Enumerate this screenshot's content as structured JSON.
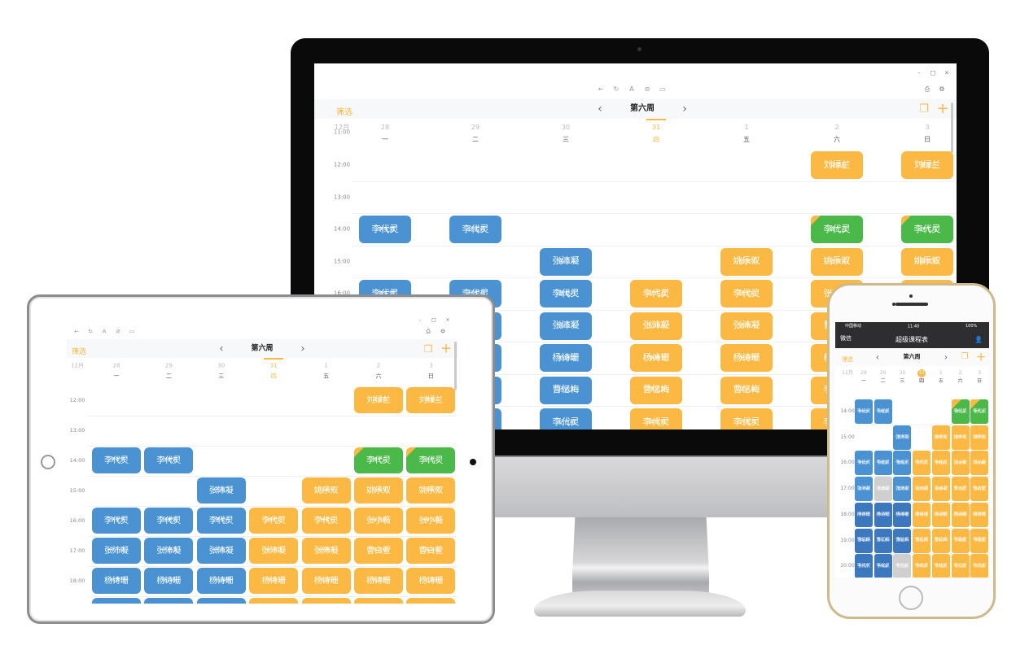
{
  "app": {
    "filter_label": "筛选",
    "week_label": "第六周",
    "month_label": "12月",
    "phone_title": "超级课程表",
    "phone_back": "微信",
    "carrier": "中国移动",
    "clock": "11:40",
    "battery": "100%"
  },
  "icons": {
    "back": "←",
    "refresh": "↻",
    "font": "A",
    "link": "⊘",
    "window": "▭",
    "share": "⎙",
    "settings": "⚙",
    "minimize": "-",
    "maximize": "□",
    "close": "×",
    "prev": "‹",
    "next": "›",
    "copy": "❐",
    "add": "+",
    "dropdown": "▾",
    "user": "👤",
    "wifi": "ᯤ"
  },
  "colors": {
    "accent": "#fbb944",
    "blue": "#4a92d2",
    "orange": "#fbb944",
    "green": "#4bb84a",
    "gray": "#cfcfcf",
    "darkblue": "#3b78bd"
  },
  "days": [
    {
      "date": "28",
      "weekday": "一"
    },
    {
      "date": "29",
      "weekday": "二"
    },
    {
      "date": "30",
      "weekday": "三"
    },
    {
      "date": "31",
      "weekday": "四"
    },
    {
      "date": "1",
      "weekday": "五"
    },
    {
      "date": "2",
      "weekday": "六"
    },
    {
      "date": "3",
      "weekday": "日"
    }
  ],
  "today_index": 3,
  "extra_time_label": "11:00",
  "schedule": [
    {
      "time": "12:00",
      "cells": [
        null,
        null,
        null,
        null,
        null,
        {
          "teacher": "刘绿兰",
          "student": "文伟嘉",
          "color": "orange"
        },
        {
          "teacher": "刘绿兰",
          "student": "萧盈兰",
          "color": "orange"
        }
      ]
    },
    {
      "time": "13:00",
      "cells": [
        null,
        null,
        null,
        null,
        null,
        null,
        null
      ]
    },
    {
      "time": "14:00",
      "cells": [
        {
          "teacher": "李代灵",
          "student": "李安梦",
          "color": "blue"
        },
        {
          "teacher": "李代灵",
          "student": "邱碧蓉",
          "color": "blue"
        },
        null,
        null,
        null,
        {
          "teacher": "李代灵",
          "student": "周芷云",
          "color": "green"
        },
        {
          "teacher": "李代灵",
          "student": "赵凡儿",
          "color": "green"
        }
      ]
    },
    {
      "time": "15:00",
      "cells": [
        null,
        null,
        {
          "teacher": "张沛凝",
          "student": "董凌文",
          "color": "blue"
        },
        null,
        {
          "teacher": "姚乐双",
          "student": "张绮琴",
          "color": "orange"
        },
        {
          "teacher": "姚乐双",
          "student": "张绮琴",
          "color": "orange"
        },
        {
          "teacher": "姚乐双",
          "student": "谭翠阳",
          "color": "orange"
        }
      ]
    },
    {
      "time": "16:00",
      "cells": [
        {
          "teacher": "李代灵",
          "student": "李安梦",
          "color": "blue"
        },
        {
          "teacher": "李代灵",
          "student": "邱碧蓉",
          "color": "blue"
        },
        {
          "teacher": "李代灵",
          "student": "董凝丹",
          "color": "blue"
        },
        {
          "teacher": "李代灵",
          "student": "胡巧蕊",
          "color": "orange"
        },
        {
          "teacher": "李代灵",
          "student": "钟青柏",
          "color": "orange"
        },
        {
          "teacher": "张小薇",
          "student": "吴语彤",
          "color": "orange"
        },
        {
          "teacher": "张小薇",
          "student": "薛钰馨",
          "color": "orange"
        }
      ]
    },
    {
      "time": "17:00",
      "cells": [
        {
          "teacher": "张沛凝",
          "student": "李千柳",
          "color": "blue"
        },
        {
          "teacher": "张沛凝",
          "student": "李思柔",
          "color": "blue",
          "phone_color": "gray"
        },
        {
          "teacher": "张沛凝",
          "student": "董凌文",
          "color": "blue"
        },
        {
          "teacher": "张沛凝",
          "student": "纪冰双",
          "color": "orange"
        },
        {
          "teacher": "张沛凝",
          "student": "谢映天",
          "color": "orange"
        },
        {
          "teacher": "曹白萱",
          "student": "于凌丝",
          "color": "orange"
        },
        {
          "teacher": "曹白萱",
          "student": "朱天蓉",
          "color": "orange"
        }
      ]
    },
    {
      "time": "18:00",
      "cells": [
        {
          "teacher": "杨诗珊",
          "student": "林梦菲",
          "color": "blue",
          "phone_color": "darkblue"
        },
        {
          "teacher": "杨诗珊",
          "student": "陈问枫",
          "color": "blue",
          "phone_color": "darkblue"
        },
        {
          "teacher": "杨诗珊",
          "student": "杨南晴",
          "color": "blue",
          "phone_color": "darkblue"
        },
        {
          "teacher": "杨诗珊",
          "student": "李绮玉",
          "color": "orange"
        },
        {
          "teacher": "杨诗珊",
          "student": "张迎曼",
          "color": "orange"
        },
        {
          "teacher": "杨诗珊",
          "student": "陈凌青",
          "color": "orange"
        },
        {
          "teacher": "杨诗珊",
          "student": "范雅柏",
          "color": "orange"
        }
      ]
    },
    {
      "time": "19:00",
      "cells": [
        {
          "teacher": "曹忆梅",
          "student": "林幽蓉",
          "color": "blue",
          "phone_color": "darkblue"
        },
        {
          "teacher": "曹忆梅",
          "student": "陈乐松",
          "color": "blue",
          "phone_color": "darkblue"
        },
        {
          "teacher": "曹忆梅",
          "student": "杨傲文",
          "color": "blue",
          "phone_color": "darkblue"
        },
        {
          "teacher": "曹忆梅",
          "student": "李嘉文",
          "color": "orange"
        },
        {
          "teacher": "曹忆梅",
          "student": "周秋翠",
          "color": "orange"
        },
        {
          "teacher": "李香萱",
          "student": "林安蕾",
          "color": "orange"
        },
        {
          "teacher": "李香萱",
          "student": "黄阳蝶",
          "color": "orange"
        }
      ]
    },
    {
      "time": "20:00",
      "cells": [
        {
          "teacher": "李代灵",
          "student": "佳寻芹",
          "color": "blue",
          "phone_color": "darkblue"
        },
        {
          "teacher": "李代灵",
          "student": "苏静美",
          "color": "blue",
          "phone_color": "darkblue"
        },
        {
          "teacher": "李代灵",
          "student": "纪白桃",
          "color": "blue",
          "phone_color": "gray"
        },
        {
          "teacher": "李代灵",
          "student": "钟翠琴",
          "color": "orange"
        },
        {
          "teacher": "李代灵",
          "student": "迟孤萍",
          "color": "orange"
        },
        {
          "teacher": "李代灵",
          "student": "彭从蓉",
          "color": "orange"
        },
        {
          "teacher": "李代灵",
          "student": "宋灵枫",
          "color": "orange"
        }
      ]
    }
  ]
}
